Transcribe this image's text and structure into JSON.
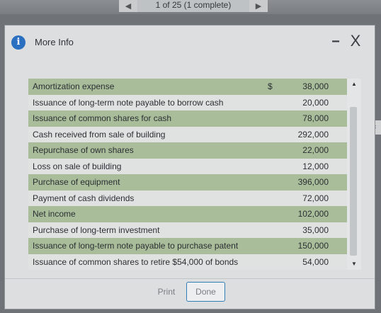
{
  "pager": {
    "label": "1 of 25 (1 complete)",
    "prev_icon": "left-arrow-icon",
    "next_icon": "right-arrow-icon"
  },
  "side_text": "fic",
  "modal": {
    "title": "More Info",
    "info_icon": "i",
    "minimize_label": "−",
    "close_label": "X"
  },
  "table": {
    "currency": "$",
    "rows": [
      {
        "label": "Amortization expense",
        "value": "38,000"
      },
      {
        "label": "Issuance of long-term note payable to borrow cash",
        "value": "20,000"
      },
      {
        "label": "Issuance of common shares for cash",
        "value": "78,000"
      },
      {
        "label": "Cash received from sale of building",
        "value": "292,000"
      },
      {
        "label": "Repurchase of own shares",
        "value": "22,000"
      },
      {
        "label": "Loss on sale of building",
        "value": "12,000"
      },
      {
        "label": "Purchase of equipment",
        "value": "396,000"
      },
      {
        "label": "Payment of cash dividends",
        "value": "72,000"
      },
      {
        "label": "Net income",
        "value": "102,000"
      },
      {
        "label": "Purchase of long-term investment",
        "value": "35,000"
      },
      {
        "label": "Issuance of long-term note payable to purchase patent",
        "value": "150,000"
      },
      {
        "label": "Issuance of common shares to retire $54,000 of bonds",
        "value": "54,000"
      }
    ]
  },
  "footer": {
    "print_label": "Print",
    "done_label": "Done"
  },
  "colors": {
    "row_shade": "#a9bd9a",
    "done_border": "#2f7fb6",
    "info_icon": "#2a6fc0"
  }
}
